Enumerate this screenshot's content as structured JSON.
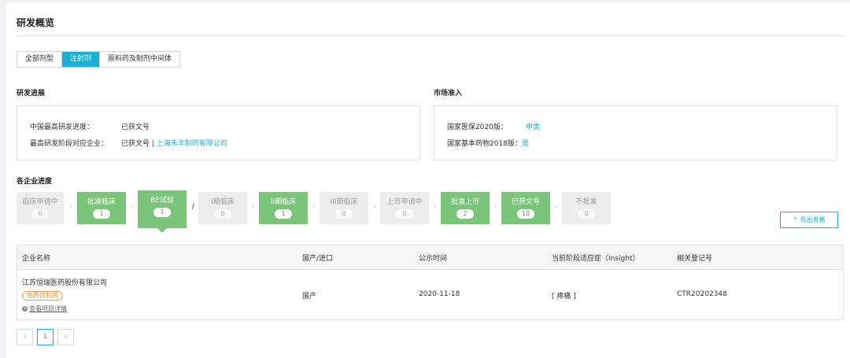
{
  "page_title": "研发概览",
  "tabs": [
    {
      "label": "全部剂型"
    },
    {
      "label": "注射剂"
    },
    {
      "label": "原料药及制剂中间体"
    }
  ],
  "rd_progress": {
    "heading": "研发进展",
    "rows": [
      {
        "label": "中国最高研发进度：",
        "value": "已获文号"
      },
      {
        "label": "最高研发阶段对应企业：",
        "value": "已获文号 | ",
        "link": "上海禾丰制药有限公司"
      }
    ]
  },
  "market_access": {
    "heading": "市场准入",
    "rows": [
      {
        "label": "国家医保2020版：",
        "value": "甲类"
      },
      {
        "label": "国家基本药物2018版：",
        "value": "是"
      }
    ]
  },
  "company_progress": {
    "heading": "各企业进度",
    "stages": [
      {
        "label": "临床申请中",
        "count": "0",
        "state": "grey"
      },
      {
        "label": "批准临床",
        "count": "1",
        "state": "green"
      },
      {
        "label": "BE试验",
        "count": "1",
        "state": "green-active"
      },
      {
        "label": "I期临床",
        "count": "0",
        "state": "grey"
      },
      {
        "label": "II期临床",
        "count": "1",
        "state": "green"
      },
      {
        "label": "III期临床",
        "count": "0",
        "state": "grey"
      },
      {
        "label": "上市申请中",
        "count": "0",
        "state": "grey"
      },
      {
        "label": "批准上市",
        "count": "2",
        "state": "green"
      },
      {
        "label": "已获文号",
        "count": "10",
        "state": "green"
      },
      {
        "label": "不批准",
        "count": "0",
        "state": "grey"
      }
    ],
    "slash": "/",
    "export_label": "导出表格"
  },
  "table": {
    "headers": [
      "企业名称",
      "国产/进口",
      "公示时间",
      "当前阶段适应症（Insight）",
      "相关登记号"
    ],
    "rows": [
      {
        "company": "江苏恒瑞医药股份有限公司",
        "tag": "化药仿制药",
        "detail": "查看项目详情",
        "origin": "国产",
        "date": "2020-11-18",
        "indication": "[ 疼痛 ]",
        "reg_no": "CTR20202348"
      }
    ]
  },
  "pagination": {
    "prev": "‹",
    "current": "1",
    "next": "›"
  },
  "colors": {
    "accent": "#1ab0d5",
    "green": "#7ac57a",
    "grey": "#ededed"
  }
}
